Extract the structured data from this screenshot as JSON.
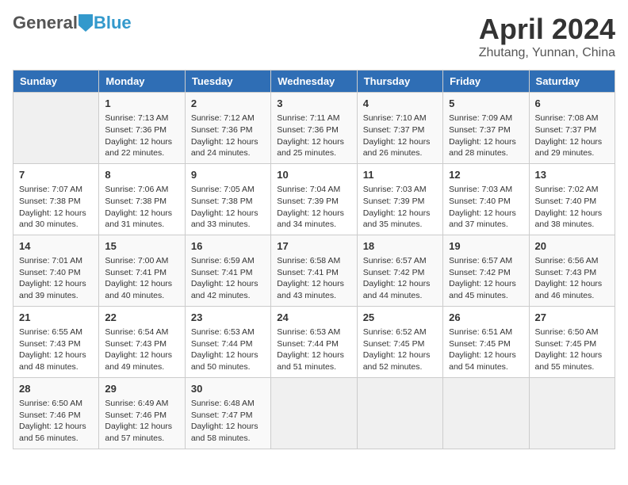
{
  "header": {
    "logo_general": "General",
    "logo_blue": "Blue",
    "title": "April 2024",
    "subtitle": "Zhutang, Yunnan, China"
  },
  "days_of_week": [
    "Sunday",
    "Monday",
    "Tuesday",
    "Wednesday",
    "Thursday",
    "Friday",
    "Saturday"
  ],
  "weeks": [
    [
      {
        "day": "",
        "empty": true
      },
      {
        "day": "1",
        "sunrise": "7:13 AM",
        "sunset": "7:36 PM",
        "daylight": "12 hours and 22 minutes."
      },
      {
        "day": "2",
        "sunrise": "7:12 AM",
        "sunset": "7:36 PM",
        "daylight": "12 hours and 24 minutes."
      },
      {
        "day": "3",
        "sunrise": "7:11 AM",
        "sunset": "7:36 PM",
        "daylight": "12 hours and 25 minutes."
      },
      {
        "day": "4",
        "sunrise": "7:10 AM",
        "sunset": "7:37 PM",
        "daylight": "12 hours and 26 minutes."
      },
      {
        "day": "5",
        "sunrise": "7:09 AM",
        "sunset": "7:37 PM",
        "daylight": "12 hours and 28 minutes."
      },
      {
        "day": "6",
        "sunrise": "7:08 AM",
        "sunset": "7:37 PM",
        "daylight": "12 hours and 29 minutes."
      }
    ],
    [
      {
        "day": "7",
        "sunrise": "7:07 AM",
        "sunset": "7:38 PM",
        "daylight": "12 hours and 30 minutes."
      },
      {
        "day": "8",
        "sunrise": "7:06 AM",
        "sunset": "7:38 PM",
        "daylight": "12 hours and 31 minutes."
      },
      {
        "day": "9",
        "sunrise": "7:05 AM",
        "sunset": "7:38 PM",
        "daylight": "12 hours and 33 minutes."
      },
      {
        "day": "10",
        "sunrise": "7:04 AM",
        "sunset": "7:39 PM",
        "daylight": "12 hours and 34 minutes."
      },
      {
        "day": "11",
        "sunrise": "7:03 AM",
        "sunset": "7:39 PM",
        "daylight": "12 hours and 35 minutes."
      },
      {
        "day": "12",
        "sunrise": "7:03 AM",
        "sunset": "7:40 PM",
        "daylight": "12 hours and 37 minutes."
      },
      {
        "day": "13",
        "sunrise": "7:02 AM",
        "sunset": "7:40 PM",
        "daylight": "12 hours and 38 minutes."
      }
    ],
    [
      {
        "day": "14",
        "sunrise": "7:01 AM",
        "sunset": "7:40 PM",
        "daylight": "12 hours and 39 minutes."
      },
      {
        "day": "15",
        "sunrise": "7:00 AM",
        "sunset": "7:41 PM",
        "daylight": "12 hours and 40 minutes."
      },
      {
        "day": "16",
        "sunrise": "6:59 AM",
        "sunset": "7:41 PM",
        "daylight": "12 hours and 42 minutes."
      },
      {
        "day": "17",
        "sunrise": "6:58 AM",
        "sunset": "7:41 PM",
        "daylight": "12 hours and 43 minutes."
      },
      {
        "day": "18",
        "sunrise": "6:57 AM",
        "sunset": "7:42 PM",
        "daylight": "12 hours and 44 minutes."
      },
      {
        "day": "19",
        "sunrise": "6:57 AM",
        "sunset": "7:42 PM",
        "daylight": "12 hours and 45 minutes."
      },
      {
        "day": "20",
        "sunrise": "6:56 AM",
        "sunset": "7:43 PM",
        "daylight": "12 hours and 46 minutes."
      }
    ],
    [
      {
        "day": "21",
        "sunrise": "6:55 AM",
        "sunset": "7:43 PM",
        "daylight": "12 hours and 48 minutes."
      },
      {
        "day": "22",
        "sunrise": "6:54 AM",
        "sunset": "7:43 PM",
        "daylight": "12 hours and 49 minutes."
      },
      {
        "day": "23",
        "sunrise": "6:53 AM",
        "sunset": "7:44 PM",
        "daylight": "12 hours and 50 minutes."
      },
      {
        "day": "24",
        "sunrise": "6:53 AM",
        "sunset": "7:44 PM",
        "daylight": "12 hours and 51 minutes."
      },
      {
        "day": "25",
        "sunrise": "6:52 AM",
        "sunset": "7:45 PM",
        "daylight": "12 hours and 52 minutes."
      },
      {
        "day": "26",
        "sunrise": "6:51 AM",
        "sunset": "7:45 PM",
        "daylight": "12 hours and 54 minutes."
      },
      {
        "day": "27",
        "sunrise": "6:50 AM",
        "sunset": "7:45 PM",
        "daylight": "12 hours and 55 minutes."
      }
    ],
    [
      {
        "day": "28",
        "sunrise": "6:50 AM",
        "sunset": "7:46 PM",
        "daylight": "12 hours and 56 minutes."
      },
      {
        "day": "29",
        "sunrise": "6:49 AM",
        "sunset": "7:46 PM",
        "daylight": "12 hours and 57 minutes."
      },
      {
        "day": "30",
        "sunrise": "6:48 AM",
        "sunset": "7:47 PM",
        "daylight": "12 hours and 58 minutes."
      },
      {
        "day": "",
        "empty": true
      },
      {
        "day": "",
        "empty": true
      },
      {
        "day": "",
        "empty": true
      },
      {
        "day": "",
        "empty": true
      }
    ]
  ],
  "labels": {
    "sunrise_prefix": "Sunrise: ",
    "sunset_prefix": "Sunset: ",
    "daylight_prefix": "Daylight: "
  }
}
